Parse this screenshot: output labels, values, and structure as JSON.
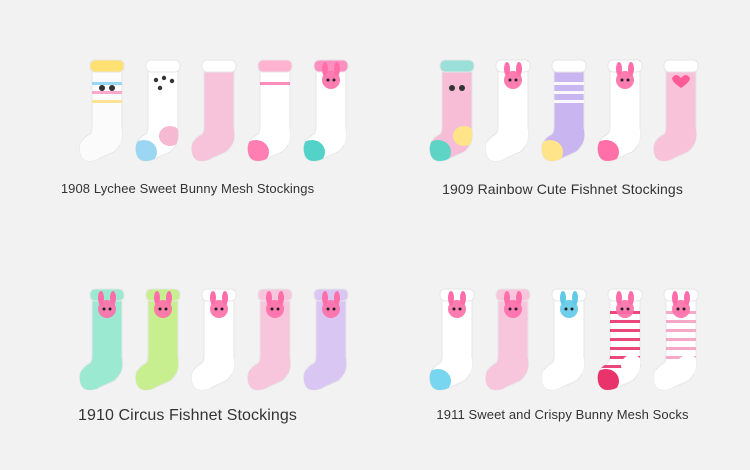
{
  "products": [
    {
      "caption": "1908 Lychee Sweet Bunny Mesh Stockings",
      "socks": [
        {
          "body": "#fbfbfb",
          "heel": "#fbfbfb",
          "toe": "#fbfbfb",
          "stripes": [
            "#8fd3f5",
            "#ff9ec8",
            "#ffe08a"
          ],
          "cuff": "#ffe070",
          "motif": "glasses"
        },
        {
          "body": "#ffffff",
          "heel": "#f7b9d2",
          "toe": "#9bd7f2",
          "stripes": [],
          "cuff": "#ffffff",
          "motif": "dots"
        },
        {
          "body": "#f6c3da",
          "heel": "#f6c3da",
          "toe": "#f6c3da",
          "stripes": [],
          "cuff": "#ffffff",
          "motif": "none"
        },
        {
          "body": "#ffffff",
          "heel": "#ffffff",
          "toe": "#ff7fb2",
          "stripes": [
            "#ff7fb2"
          ],
          "cuff": "#ffb3cf",
          "motif": "none"
        },
        {
          "body": "#ffffff",
          "heel": "#ffffff",
          "toe": "#52d2c8",
          "stripes": [],
          "cuff": "#ff8fbf",
          "motif": "bunny"
        }
      ]
    },
    {
      "caption": "1909 Rainbow Cute Fishnet Stockings",
      "socks": [
        {
          "body": "#f7bcd6",
          "heel": "#ffe48a",
          "toe": "#5ed4c7",
          "stripes": [],
          "cuff": "#9be0d8",
          "motif": "eyes"
        },
        {
          "body": "#ffffff",
          "heel": "#ffffff",
          "toe": "#ffffff",
          "stripes": [],
          "cuff": "#ffffff",
          "motif": "mouse"
        },
        {
          "body": "#c9b6f0",
          "heel": "#c9b6f0",
          "toe": "#ffe48a",
          "stripes": [
            "#ffffff",
            "#ffffff",
            "#ffffff"
          ],
          "cuff": "#ffffff",
          "motif": "none"
        },
        {
          "body": "#ffffff",
          "heel": "#ffffff",
          "toe": "#ff6fa8",
          "stripes": [],
          "cuff": "#ffffff",
          "motif": "bunny"
        },
        {
          "body": "#f8c3d9",
          "heel": "#f8c3d9",
          "toe": "#f8c3d9",
          "stripes": [],
          "cuff": "#ffffff",
          "motif": "heart"
        }
      ]
    },
    {
      "caption": "1910 Circus Fishnet Stockings",
      "socks": [
        {
          "body": "#9ce9d2",
          "heel": "#9ce9d2",
          "toe": "#9ce9d2",
          "stripes": [],
          "cuff": "#9ce9d2",
          "motif": "bear"
        },
        {
          "body": "#c7ef8f",
          "heel": "#c7ef8f",
          "toe": "#c7ef8f",
          "stripes": [],
          "cuff": "#c7ef8f",
          "motif": "dog"
        },
        {
          "body": "#ffffff",
          "heel": "#ffffff",
          "toe": "#ffffff",
          "stripes": [],
          "cuff": "#ffffff",
          "motif": "dog"
        },
        {
          "body": "#f8c6dc",
          "heel": "#f8c6dc",
          "toe": "#f8c6dc",
          "stripes": [],
          "cuff": "#f8c6dc",
          "motif": "koala"
        },
        {
          "body": "#d9c6f3",
          "heel": "#d9c6f3",
          "toe": "#d9c6f3",
          "stripes": [],
          "cuff": "#d9c6f3",
          "motif": "bunny"
        }
      ]
    },
    {
      "caption": "1911 Sweet and Crispy Bunny Mesh Socks",
      "socks": [
        {
          "body": "#ffffff",
          "heel": "#ffffff",
          "toe": "#79d6f0",
          "stripes": [],
          "cuff": "#ffffff",
          "motif": "pinkbunny"
        },
        {
          "body": "#f8c6dc",
          "heel": "#f8c6dc",
          "toe": "#f8c6dc",
          "stripes": [],
          "cuff": "#f8c6dc",
          "motif": "bunny"
        },
        {
          "body": "#ffffff",
          "heel": "#ffffff",
          "toe": "#ffffff",
          "stripes": [],
          "cuff": "#ffffff",
          "motif": "bluebunny"
        },
        {
          "body": "#ffffff",
          "heel": "#ffffff",
          "toe": "#e8336d",
          "stripes": [
            "#e8336d",
            "#e8336d",
            "#e8336d",
            "#e8336d",
            "#e8336d",
            "#e8336d",
            "#e8336d"
          ],
          "cuff": "#ffffff",
          "motif": "crab"
        },
        {
          "body": "#ffffff",
          "heel": "#ffffff",
          "toe": "#ffffff",
          "stripes": [
            "#f5a0c0",
            "#f5a0c0",
            "#f5a0c0",
            "#f5a0c0",
            "#f5a0c0",
            "#f5a0c0"
          ],
          "cuff": "#ffffff",
          "motif": "strawberry"
        }
      ]
    }
  ],
  "colors": {
    "background": "#f2f2f2",
    "caption": "#333333"
  }
}
